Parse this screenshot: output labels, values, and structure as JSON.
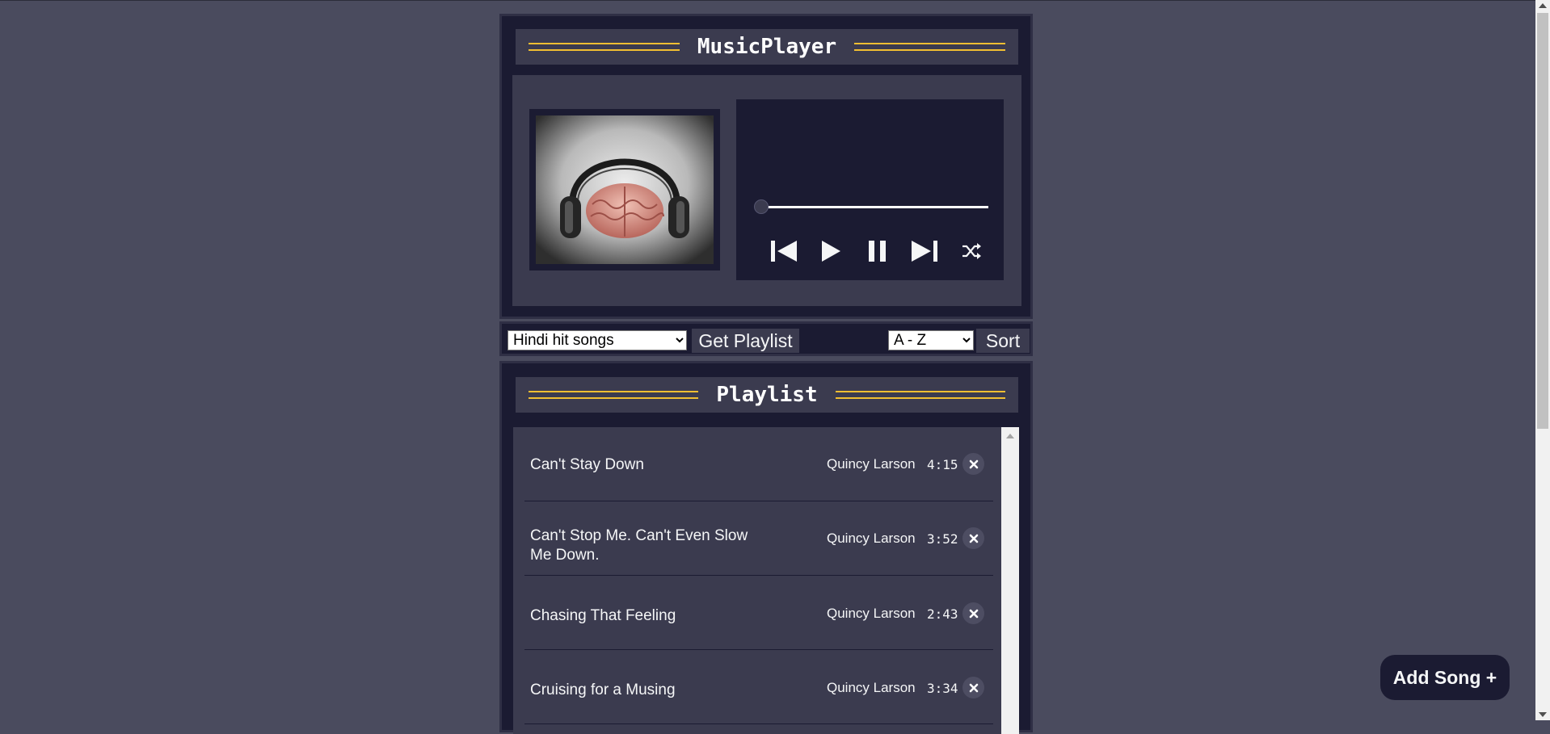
{
  "app": {
    "title": "MusicPlayer"
  },
  "player": {
    "album_art_icon": "brain-headphones-image",
    "progress_fraction": 0.0,
    "controls": [
      {
        "name": "previous-button",
        "icon": "skip-previous-icon"
      },
      {
        "name": "play-button",
        "icon": "play-icon"
      },
      {
        "name": "pause-button",
        "icon": "pause-icon"
      },
      {
        "name": "next-button",
        "icon": "skip-next-icon"
      },
      {
        "name": "shuffle-button",
        "icon": "shuffle-icon"
      }
    ]
  },
  "toolbar": {
    "playlist_selected": "Hindi hit songs",
    "get_playlist_label": "Get Playlist",
    "sort_selected": "A - Z",
    "sort_label": "Sort"
  },
  "playlist": {
    "title": "Playlist",
    "songs": [
      {
        "title": "Can't Stay Down",
        "artist": "Quincy Larson",
        "duration": "4:15"
      },
      {
        "title": "Can't Stop Me. Can't Even Slow Me Down.",
        "artist": "Quincy Larson",
        "duration": "3:52"
      },
      {
        "title": "Chasing That Feeling",
        "artist": "Quincy Larson",
        "duration": "2:43"
      },
      {
        "title": "Cruising for a Musing",
        "artist": "Quincy Larson",
        "duration": "3:34"
      }
    ]
  },
  "add_song": {
    "label": "Add Song +"
  },
  "colors": {
    "page_bg": "#4a4b5e",
    "panel_dark": "#1b1b32",
    "panel_mid": "#3b3b4f",
    "accent_yellow": "#f1be32",
    "text_light": "#f5f6f7"
  }
}
